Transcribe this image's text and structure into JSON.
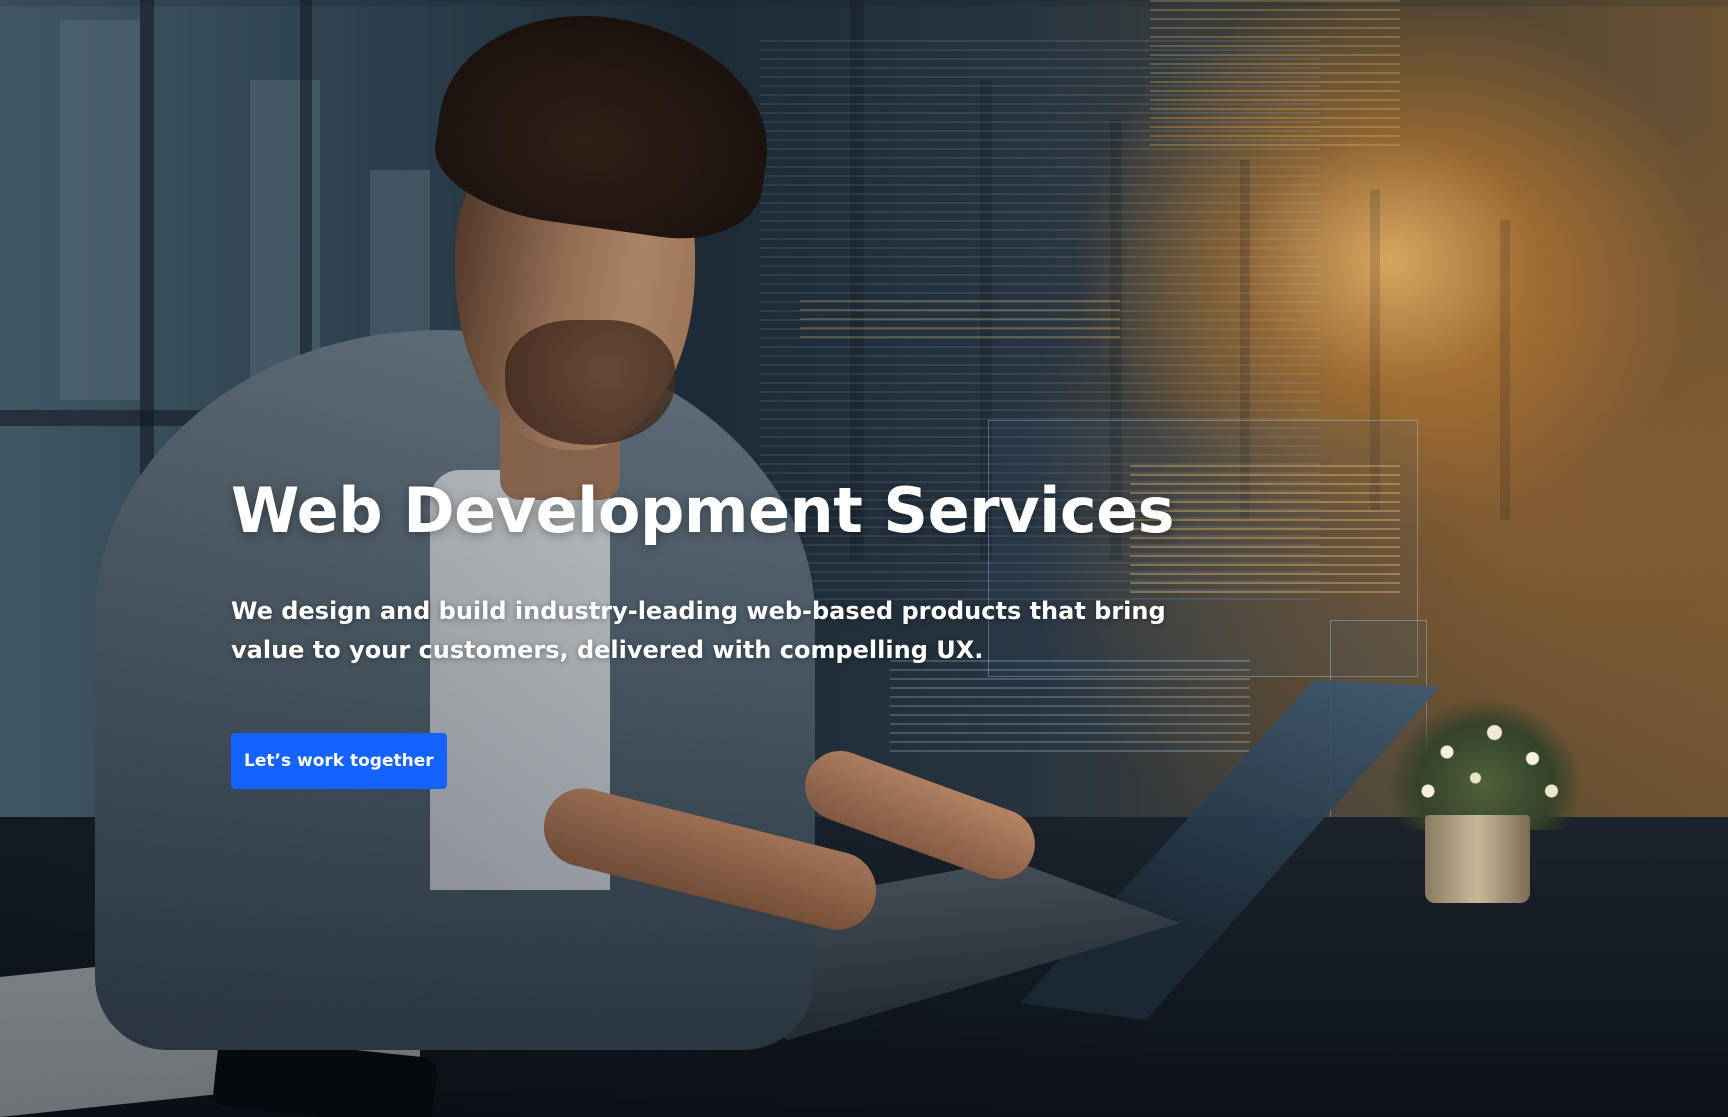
{
  "hero": {
    "title": "Web Development Services",
    "subtitle": "We design and build industry-leading web-based products that bring value to your customers, delivered with compelling UX.",
    "cta_label": "Let’s work together"
  },
  "colors": {
    "cta_background": "#1463ff",
    "text": "#ffffff"
  }
}
